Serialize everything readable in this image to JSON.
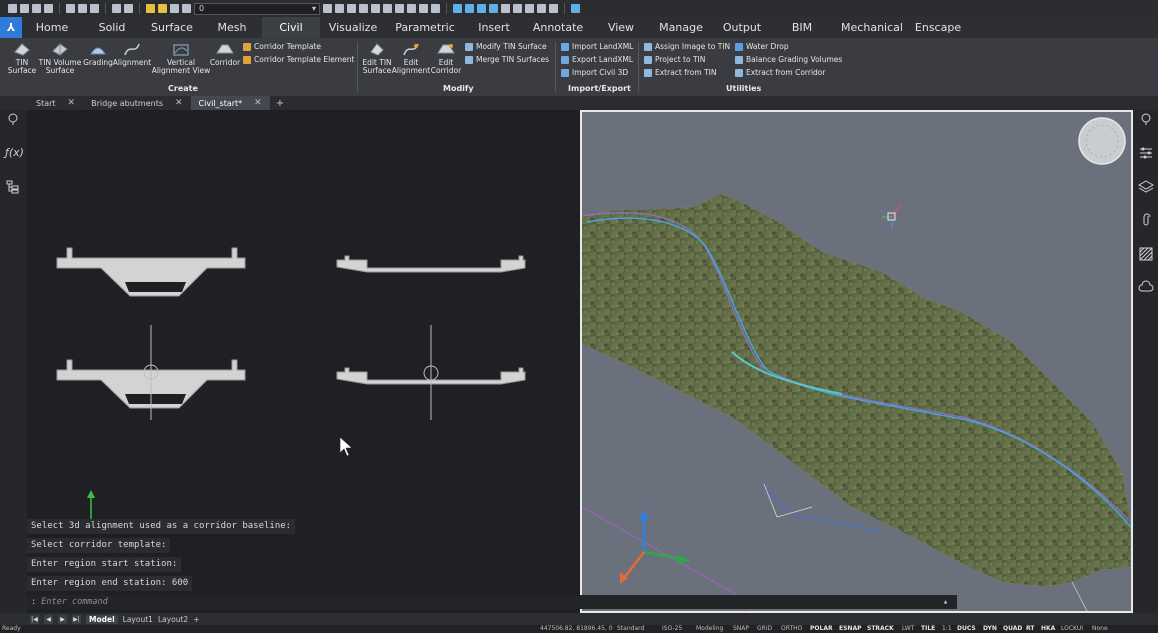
{
  "quick_access": {
    "layer_value": "0"
  },
  "ribbon_tabs": [
    "Home",
    "Solid",
    "Surface",
    "Mesh",
    "Civil",
    "Visualize",
    "Parametric",
    "Insert",
    "Annotate",
    "View",
    "Manage",
    "Output",
    "BIM",
    "Mechanical",
    "Enscape"
  ],
  "active_tab": "Civil",
  "ribbon": {
    "create": {
      "label": "Create",
      "tin_surface": "TIN\nSurface",
      "tin_volume_surface": "TIN Volume\nSurface",
      "grading": "Grading",
      "alignment": "Alignment",
      "vertical_alignment_view": "Vertical\nAlignment View",
      "corridor": "Corridor",
      "corridor_template": "Corridor Template",
      "corridor_template_element": "Corridor Template Element"
    },
    "modify": {
      "label": "Modify",
      "edit_tin_surface": "Edit TIN\nSurface",
      "edit_alignment": "Edit\nAlignment",
      "edit_corridor": "Edit\nCorridor",
      "modify_tin_surface": "Modify TIN Surface",
      "merge_tin_surfaces": "Merge TIN Surfaces"
    },
    "import_export": {
      "label": "Import/Export",
      "import_landxml": "Import LandXML",
      "export_landxml": "Export LandXML",
      "import_civil_3d": "Import Civil 3D"
    },
    "utilities": {
      "label": "Utilities",
      "assign_image_to_tin": "Assign Image to TIN",
      "project_to_tin": "Project to TIN",
      "extract_from_tin": "Extract from TIN",
      "water_drop": "Water Drop",
      "balance_grading_volumes": "Balance Grading Volumes",
      "extract_from_corridor": "Extract from Corridor"
    }
  },
  "doc_tabs": [
    {
      "label": "Start",
      "close": "✕"
    },
    {
      "label": "Bridge abutments",
      "close": "✕"
    },
    {
      "label": "Civil_start*",
      "close": "✕"
    }
  ],
  "doc_tab_add": "+",
  "left_tools": {
    "formula": "ƒ(x)"
  },
  "command_history": [
    "Select 3d alignment used as a corridor baseline:",
    "Select corridor template:",
    "Enter region start station:",
    "Enter region end station: 600"
  ],
  "command_prompt_prefix": ":",
  "command_placeholder": "Enter command",
  "layout_tabs": [
    "Model",
    "Layout1",
    "Layout2"
  ],
  "layout_add": "+",
  "layout_nav": [
    "|◀",
    "◀",
    "▶",
    "▶|"
  ],
  "status": {
    "ready": "Ready",
    "coords": "447506.82, 81896.45, 0",
    "standard": "Standard",
    "iso": "ISO-25",
    "workspace": "Modeling",
    "toggles": [
      "SNAP",
      "GRID",
      "ORTHO",
      "POLAR",
      "ESNAP",
      "STRACK",
      "LWT",
      "TILE",
      "1:1",
      "DUCS",
      "DYN",
      "QUAD",
      "RT",
      "HKA",
      "LOCKUI",
      "None"
    ]
  },
  "colors": {
    "accent": "#2f7bd9",
    "ribbon_bg": "#3a3c41",
    "viewport_bg": "#1e2023",
    "view3d_bg": "#6b717c"
  }
}
